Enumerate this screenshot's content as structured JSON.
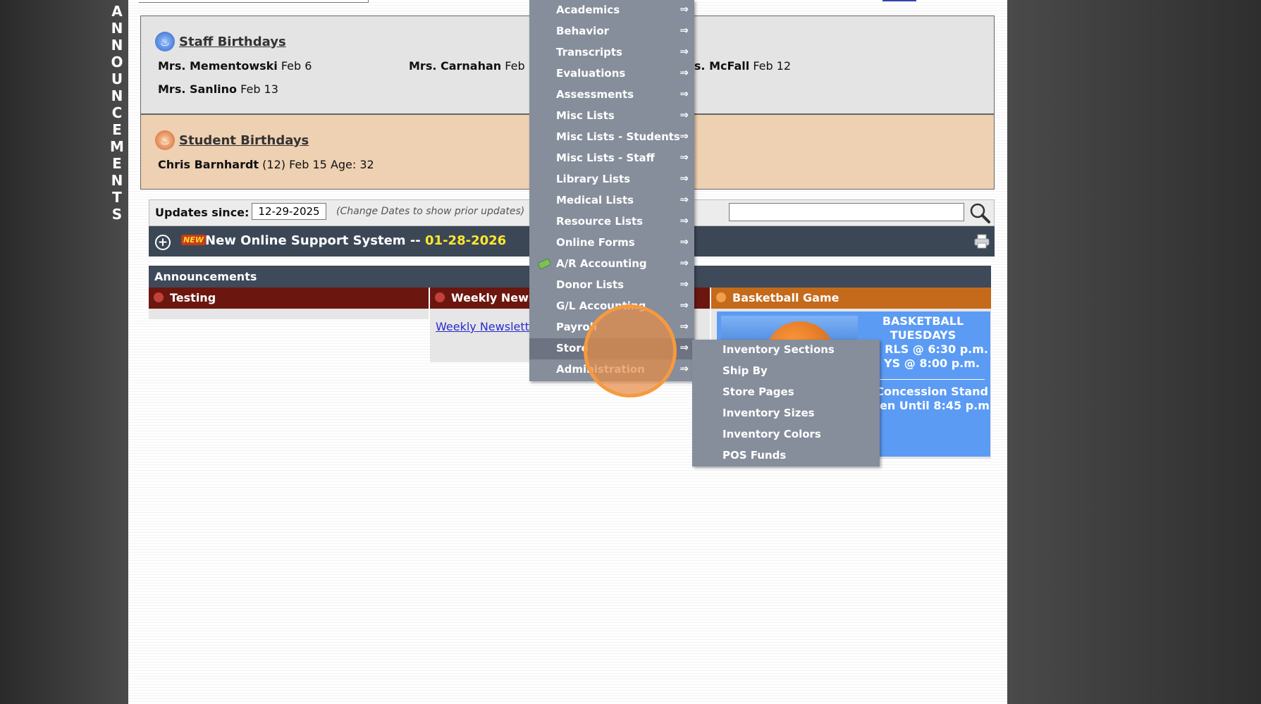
{
  "side_banner": {
    "letters": [
      "A",
      "N",
      "N",
      "O",
      "U",
      "N",
      "C",
      "E",
      "M",
      "E",
      "N",
      "T",
      "S"
    ]
  },
  "staff_birthdays": {
    "title": "Staff Birthdays",
    "people": [
      {
        "name": "Mrs. Mementowski",
        "date": "Feb 6"
      },
      {
        "name": "Mrs. Carnahan",
        "date": "Feb"
      },
      {
        "name": "rs. McFall",
        "date": "Feb 12"
      },
      {
        "name": "Mrs. Sanlino",
        "date": "Feb 13"
      }
    ]
  },
  "student_birthdays": {
    "title": "Student Birthdays",
    "people": [
      {
        "name": "Chris Barnhardt",
        "detail": "(12) Feb 15 Age: 32"
      }
    ]
  },
  "updates": {
    "label": "Updates since:",
    "date_value": "12-29-2025",
    "note": "(Change Dates to show prior updates)",
    "search_value": ""
  },
  "news": {
    "badge": "NEW",
    "title": "New Online Support System -- ",
    "date": "01-28-2026"
  },
  "announcements": {
    "header": "Announcements",
    "columns": [
      {
        "title": "Testing"
      },
      {
        "title": "Weekly Newsl",
        "link": "Weekly Newslette"
      },
      {
        "title": "Basketball Game",
        "lines": [
          "BASKETBALL",
          "TUESDAYS",
          "RLS @ 6:30 p.m.",
          "YS  @ 8:00 p.m.",
          "Concession Stand",
          "en Until 8:45 p.m."
        ]
      }
    ]
  },
  "menu": {
    "arrow": "⇒",
    "items": [
      {
        "label": "Academics"
      },
      {
        "label": "Behavior"
      },
      {
        "label": "Transcripts"
      },
      {
        "label": "Evaluations"
      },
      {
        "label": "Assessments"
      },
      {
        "label": "Misc Lists"
      },
      {
        "label": "Misc Lists - Students"
      },
      {
        "label": "Misc Lists - Staff"
      },
      {
        "label": "Library Lists"
      },
      {
        "label": "Medical Lists"
      },
      {
        "label": "Resource Lists"
      },
      {
        "label": "Online Forms"
      },
      {
        "label": "A/R Accounting"
      },
      {
        "label": "Donor Lists"
      },
      {
        "label": "G/L Accounting"
      },
      {
        "label": "Payroll"
      },
      {
        "label": "Store"
      },
      {
        "label": "Administration"
      }
    ],
    "active_item": "Store"
  },
  "submenu": {
    "items": [
      {
        "label": "Inventory Sections"
      },
      {
        "label": "Ship By"
      },
      {
        "label": "Store Pages"
      },
      {
        "label": "Inventory Sizes"
      },
      {
        "label": "Inventory Colors"
      },
      {
        "label": "POS Funds"
      }
    ]
  },
  "colors": {
    "menu_bg": "#868d9b",
    "news_bar": "#3c4756",
    "column_red": "#6b1710",
    "column_orange": "#c46a1a",
    "basketball_blue": "#5b9bf4",
    "news_date": "#ffe82e",
    "click_highlight": "#f59a40"
  }
}
